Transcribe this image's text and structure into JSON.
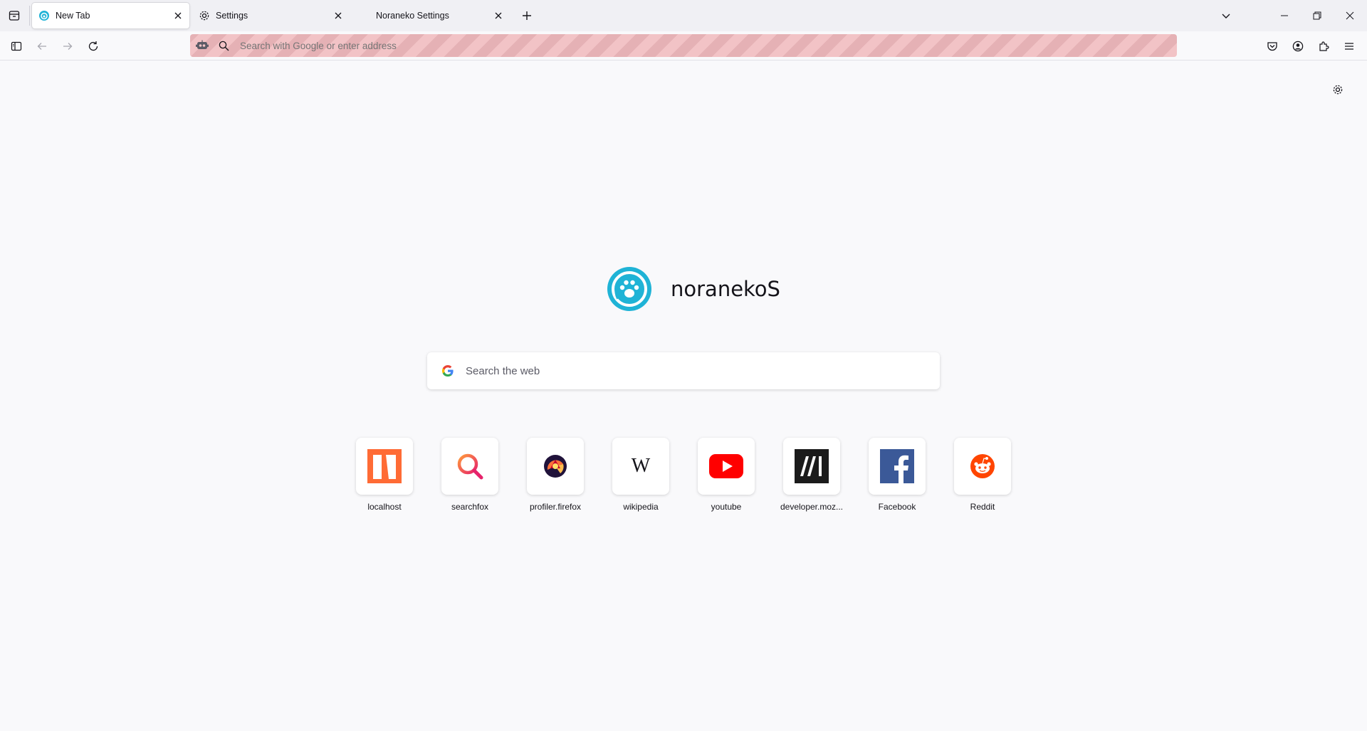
{
  "tabs": [
    {
      "title": "New Tab",
      "icon": "noraneko-icon",
      "active": true
    },
    {
      "title": "Settings",
      "icon": "gear-icon",
      "active": false
    },
    {
      "title": "Noraneko Settings",
      "icon": "",
      "active": false
    }
  ],
  "urlbar": {
    "placeholder": "Search with Google or enter address"
  },
  "logo": {
    "wordmark": "noranekoS",
    "color": "#1fb3d6"
  },
  "websearch": {
    "placeholder": "Search the web"
  },
  "topsites": [
    {
      "label": "localhost",
      "icon": "localhost-icon"
    },
    {
      "label": "searchfox",
      "icon": "searchfox-icon"
    },
    {
      "label": "profiler.firefox",
      "icon": "profiler-icon"
    },
    {
      "label": "wikipedia",
      "icon": "wikipedia-icon"
    },
    {
      "label": "youtube",
      "icon": "youtube-icon"
    },
    {
      "label": "developer.moz...",
      "icon": "mdn-icon"
    },
    {
      "label": "Facebook",
      "icon": "facebook-icon"
    },
    {
      "label": "Reddit",
      "icon": "reddit-icon"
    }
  ]
}
